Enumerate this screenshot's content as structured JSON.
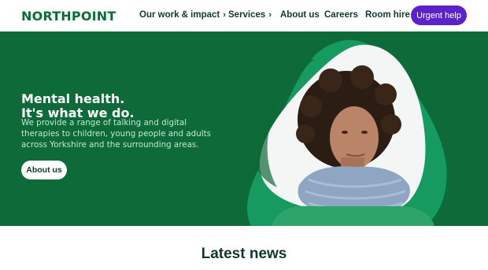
{
  "brand": {
    "logo_text": "NORTHPOINT",
    "primary_green": "#0e6a39",
    "accent_purple": "#5b23c7"
  },
  "nav": {
    "items": [
      {
        "label": "Our work & impact",
        "has_chevron": true,
        "chevron_icon": "chevron-right-icon"
      },
      {
        "label": "Services",
        "has_chevron": true,
        "chevron_icon": "chevron-right-icon"
      },
      {
        "label": "About us",
        "has_chevron": false
      },
      {
        "label": "Careers",
        "has_chevron": false
      },
      {
        "label": "Room hire",
        "has_chevron": false
      }
    ],
    "cta_label": "Urgent help"
  },
  "hero": {
    "title_line1": "Mental health.",
    "title_line2": "It's what we do.",
    "body": "We provide a range of talking and digital therapies to children, young people and adults across Yorkshire and the surrounding areas.",
    "button_label": "About us",
    "image_subject": "portrait of a woman with curly hair wearing a blue knitted scarf"
  },
  "news": {
    "heading": "Latest news"
  }
}
